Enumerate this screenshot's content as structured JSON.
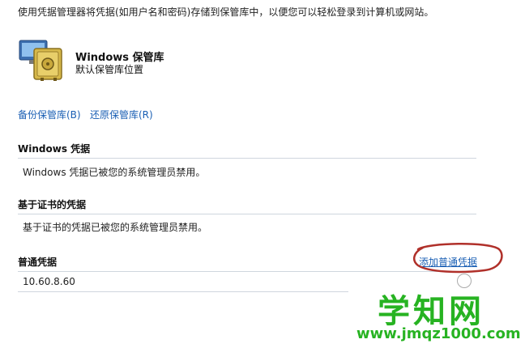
{
  "intro_text": "使用凭据管理器将凭据(如用户名和密码)存储到保管库中，以便您可以轻松登录到计算机或网站。",
  "vault": {
    "title": "Windows 保管库",
    "subtitle": "默认保管库位置",
    "icon": "vault-safe-icon"
  },
  "actions": {
    "backup_label": "备份保管库(B)",
    "restore_label": "还原保管库(R)"
  },
  "sections": {
    "windows": {
      "header": "Windows 凭据",
      "message": "Windows 凭据已被您的系统管理员禁用。"
    },
    "certificate": {
      "header": "基于证书的凭据",
      "message": "基于证书的凭据已被您的系统管理员禁用。"
    },
    "generic": {
      "header": "普通凭据",
      "add_label": "添加普通凭据",
      "items": [
        {
          "name": "10.60.8.60"
        }
      ]
    }
  },
  "watermark": {
    "brand": "学知网",
    "url": "www.jmqz1000.com"
  },
  "colors": {
    "link": "#1a5fb4",
    "annotation_circle": "#b0302a",
    "watermark": "#27b322"
  }
}
